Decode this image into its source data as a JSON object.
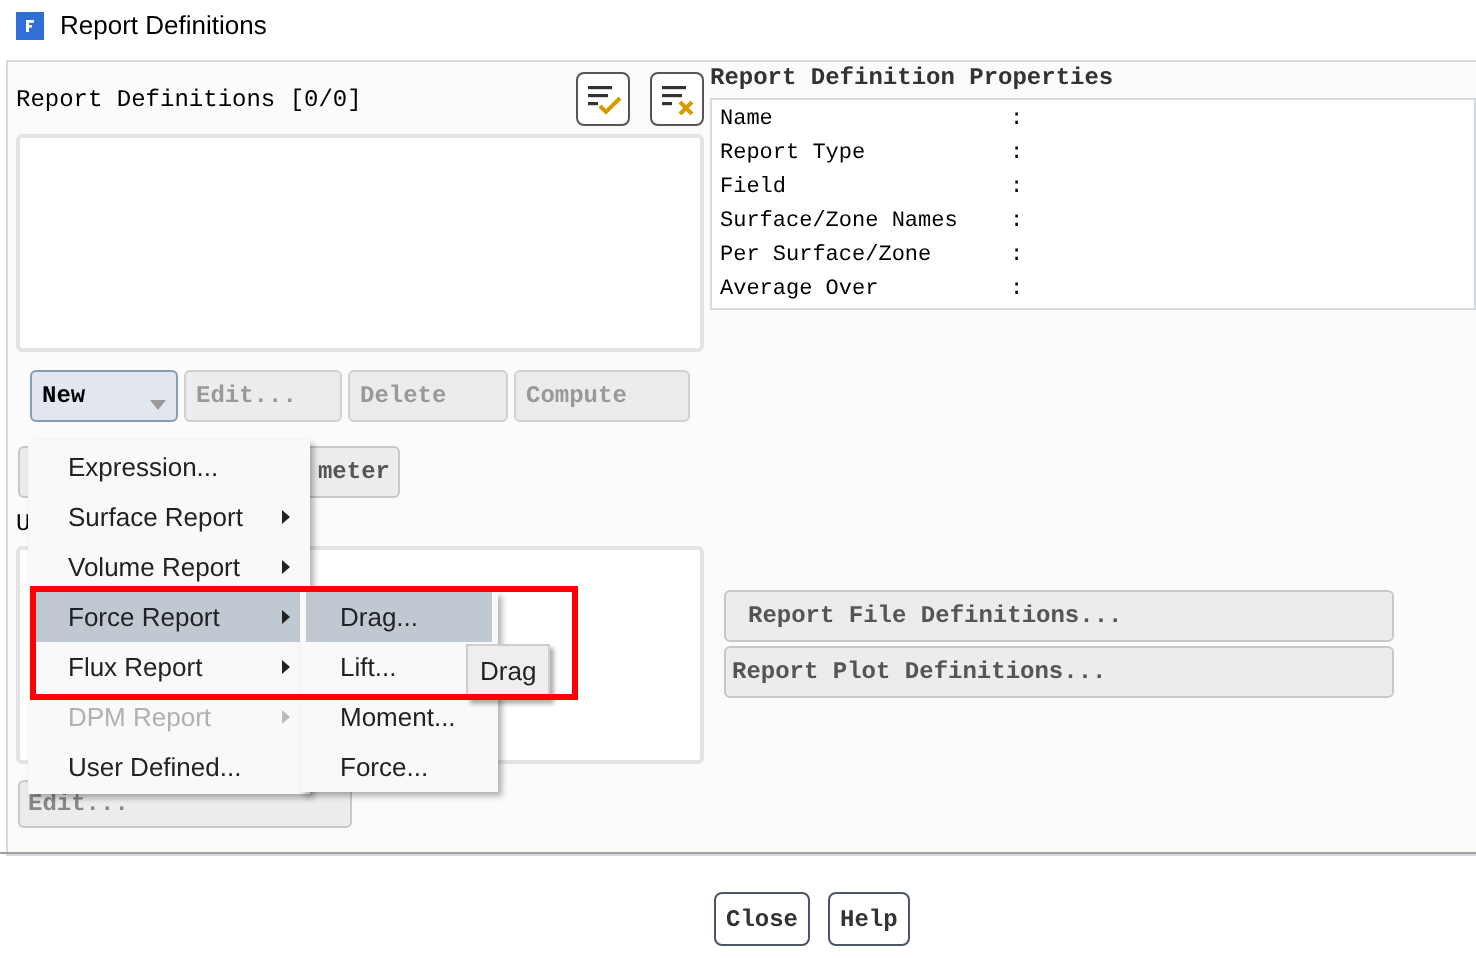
{
  "window": {
    "title": "Report Definitions"
  },
  "definitions": {
    "label": "Report Definitions [0/0]",
    "buttons": [
      {
        "label": "New",
        "kind": "dropdown",
        "disabled": false
      },
      {
        "label": "Edit...",
        "kind": "plain",
        "disabled": true
      },
      {
        "label": "Delete",
        "kind": "plain",
        "disabled": true
      },
      {
        "label": "Compute",
        "kind": "plain",
        "disabled": true
      }
    ],
    "partial_button": "meter"
  },
  "lower": {
    "label": "U",
    "edit_button": "Edit..."
  },
  "properties": {
    "title": "Report Definition Properties",
    "rows": [
      {
        "name": "Name",
        "separator": ":"
      },
      {
        "name": "Report Type",
        "separator": ":"
      },
      {
        "name": "Field",
        "separator": ":"
      },
      {
        "name": "Surface/Zone Names",
        "separator": ":"
      },
      {
        "name": "Per Surface/Zone",
        "separator": ":"
      },
      {
        "name": "Average Over",
        "separator": ":"
      }
    ]
  },
  "side_buttons": [
    "Report File Definitions...",
    "Report Plot Definitions..."
  ],
  "footer_buttons": [
    "Close",
    "Help"
  ],
  "menu": {
    "items": [
      {
        "label": "Expression...",
        "submenu": false,
        "selected": false,
        "disabled": false
      },
      {
        "label": "Surface Report",
        "submenu": true,
        "selected": false,
        "disabled": false
      },
      {
        "label": "Volume Report",
        "submenu": true,
        "selected": false,
        "disabled": false
      },
      {
        "label": "Force Report",
        "submenu": true,
        "selected": true,
        "disabled": false
      },
      {
        "label": "Flux Report",
        "submenu": true,
        "selected": false,
        "disabled": false
      },
      {
        "label": "DPM Report",
        "submenu": true,
        "selected": false,
        "disabled": true
      },
      {
        "label": "User Defined...",
        "submenu": false,
        "selected": false,
        "disabled": false
      }
    ]
  },
  "submenu": {
    "items": [
      {
        "label": "Drag...",
        "selected": true
      },
      {
        "label": "Lift...",
        "selected": false
      },
      {
        "label": "Moment...",
        "selected": false
      },
      {
        "label": "Force...",
        "selected": false
      }
    ]
  },
  "tooltip": "Drag"
}
